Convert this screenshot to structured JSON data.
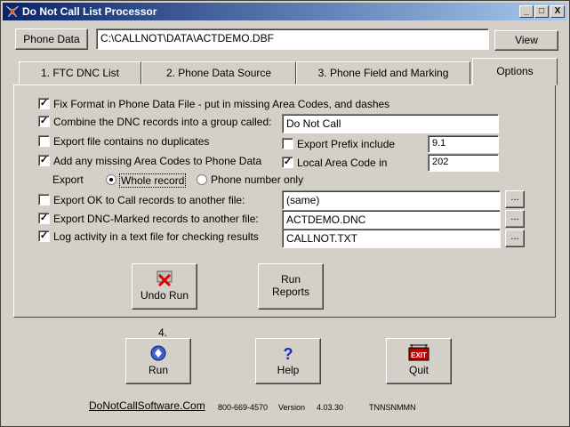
{
  "window": {
    "title": "Do Not Call List Processor",
    "minimize": "_",
    "maximize": "□",
    "close": "X"
  },
  "toolbar": {
    "phone_data_button": "Phone Data",
    "file_path": "C:\\CALLNOT\\DATA\\ACTDEMO.DBF",
    "view_button": "View"
  },
  "tabs": [
    "1. FTC DNC List",
    "2. Phone Data Source",
    "3. Phone Field and Marking",
    "Options"
  ],
  "options": {
    "fix_format": {
      "label": "Fix Format in Phone Data File - put in missing Area Codes, and dashes",
      "checked": true
    },
    "combine": {
      "label": "Combine the DNC records into a group called:",
      "checked": true,
      "value": "Do Not Call"
    },
    "no_duplicates": {
      "label": "Export file contains no duplicates",
      "checked": false
    },
    "export_prefix": {
      "label": "Export  Prefix include",
      "checked": false,
      "value": "9.1"
    },
    "add_area_codes": {
      "label": "Add any missing Area Codes to Phone Data",
      "checked": true
    },
    "local_area_code": {
      "label": "Local Area Code in",
      "checked": true,
      "value": "202"
    },
    "export_label": "Export",
    "export_whole": {
      "label": "Whole record",
      "selected": true
    },
    "export_phone": {
      "label": "Phone number only",
      "selected": false
    },
    "export_ok": {
      "label": "Export OK to Call records to another file:",
      "checked": false,
      "value": "(same)"
    },
    "export_dnc": {
      "label": "Export DNC-Marked records to another file:",
      "checked": true,
      "value": "ACTDEMO.DNC"
    },
    "log_activity": {
      "label": "Log activity in a text file for checking results",
      "checked": true,
      "value": "CALLNOT.TXT"
    },
    "browse": "...",
    "undo_run": "Undo Run",
    "run_reports_1": "Run",
    "run_reports_2": "Reports"
  },
  "bottom": {
    "step": "4.",
    "run": "Run",
    "help": "Help",
    "quit": "Quit",
    "quit_sign": "EXIT",
    "website": "DoNotCallSoftware.Com",
    "phone": "800-669-4570",
    "version_label": "Version",
    "version": "4.03.30",
    "code": "TNNSNMMN"
  }
}
